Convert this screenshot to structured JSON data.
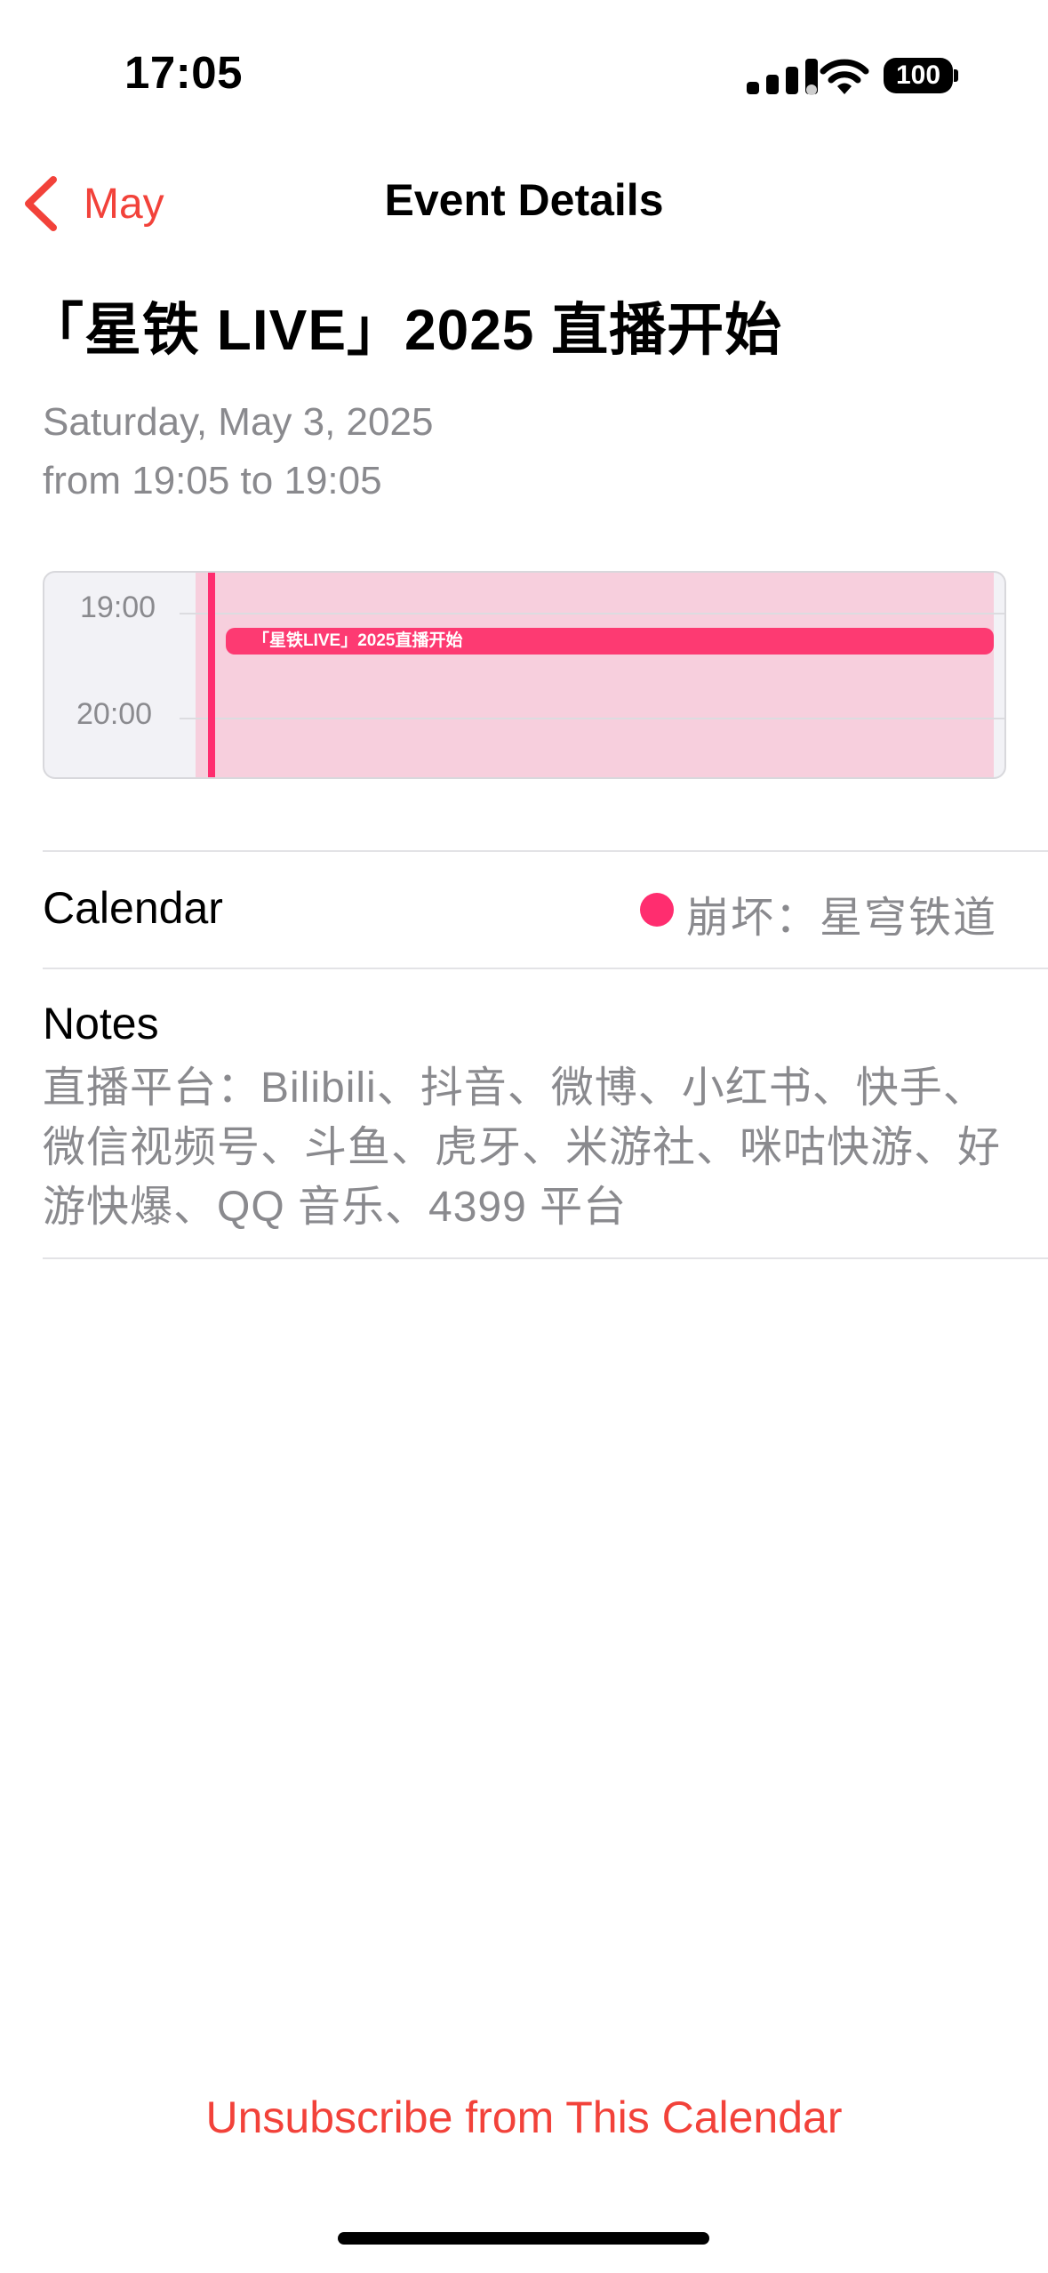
{
  "status_bar": {
    "time": "17:05",
    "battery": "100",
    "icons": [
      "cellular-signal-icon",
      "wifi-icon",
      "battery-icon"
    ]
  },
  "nav": {
    "back_label": "May",
    "title": "Event Details",
    "accent_color": "#f2423a"
  },
  "event": {
    "title": "「星铁 LIVE」2025 直播开始",
    "date": "Saturday, May 3, 2025",
    "time_range": "from 19:05 to 19:05"
  },
  "timeline": {
    "hours": [
      "19:00",
      "20:00"
    ],
    "event_label": "「星铁LIVE」2025直播开始",
    "event_color": "#ff2d6f"
  },
  "calendar": {
    "label": "Calendar",
    "name": "崩坏：星穹铁道",
    "color": "#ff2d6f"
  },
  "notes": {
    "label": "Notes",
    "text": "直播平台：Bilibili、抖音、微博、小红书、快手、微信视频号、斗鱼、虎牙、米游社、咪咕快游、好游快爆、QQ 音乐、4399 平台"
  },
  "actions": {
    "unsubscribe": "Unsubscribe from This Calendar"
  }
}
